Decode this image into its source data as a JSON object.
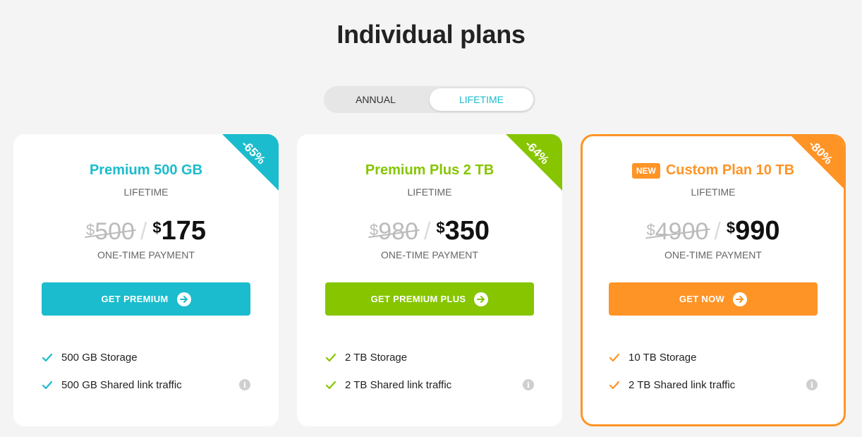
{
  "page": {
    "title": "Individual plans"
  },
  "toggle": {
    "annual": "ANNUAL",
    "lifetime": "LIFETIME",
    "active": "lifetime"
  },
  "plans": [
    {
      "name": "Premium 500 GB",
      "badge": "",
      "term": "LIFETIME",
      "discount": "-65%",
      "old_currency": "$",
      "old_price": "500",
      "new_currency": "$",
      "new_price": "175",
      "payment_note": "ONE-TIME PAYMENT",
      "cta": "GET PREMIUM",
      "color": "#1bbccd",
      "features": [
        "500 GB Storage",
        "500 GB Shared link traffic"
      ],
      "info_icon": "info-icon"
    },
    {
      "name": "Premium Plus 2 TB",
      "badge": "",
      "term": "LIFETIME",
      "discount": "-64%",
      "old_currency": "$",
      "old_price": "980",
      "new_currency": "$",
      "new_price": "350",
      "payment_note": "ONE-TIME PAYMENT",
      "cta": "GET PREMIUM PLUS",
      "color": "#86c500",
      "features": [
        "2 TB Storage",
        "2 TB Shared link traffic"
      ],
      "info_icon": "info-icon"
    },
    {
      "name": "Custom Plan 10 TB",
      "badge": "NEW",
      "term": "LIFETIME",
      "discount": "-80%",
      "old_currency": "$",
      "old_price": "4900",
      "new_currency": "$",
      "new_price": "990",
      "payment_note": "ONE-TIME PAYMENT",
      "cta": "GET NOW",
      "color": "#ff9426",
      "features": [
        "10 TB Storage",
        "2 TB Shared link traffic"
      ],
      "info_icon": "info-icon"
    }
  ]
}
